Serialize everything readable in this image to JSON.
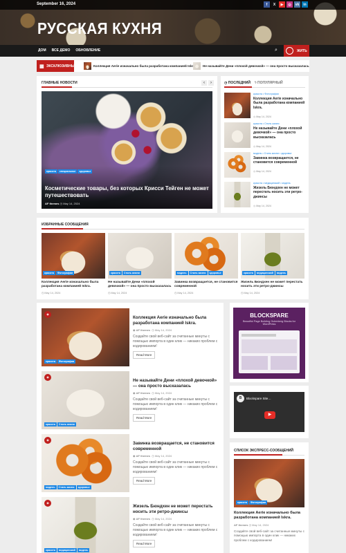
{
  "header": {
    "date": "September 16, 2024",
    "site_title": "РУССКАЯ КУХНЯ",
    "socials": [
      {
        "name": "facebook-icon",
        "glyph": "f",
        "color": "#3b5998"
      },
      {
        "name": "x-icon",
        "glyph": "X",
        "color": "#111111"
      },
      {
        "name": "youtube-icon",
        "glyph": "▶",
        "color": "#e52d27"
      },
      {
        "name": "instagram-icon",
        "glyph": "◎",
        "color": "#c13584"
      },
      {
        "name": "vk-icon",
        "glyph": "vk",
        "color": "#4a76a8"
      },
      {
        "name": "linkedin-icon",
        "glyph": "in",
        "color": "#0077b5"
      }
    ],
    "nav": [
      "ДОМ",
      "ВСЕ ДЕМО",
      "ОБНОВЛЕНИЕ"
    ],
    "live_label": "ЖИТЬ"
  },
  "exclusive": {
    "label": "ЭКСКЛЮЗИВНЫЙ",
    "items": [
      "Коллекция Aerie изначально была разработана компанией Iskra.",
      "Не называйте Дени «плохой девочкой» — она просто высказалась"
    ]
  },
  "main_news": {
    "heading": "ГЛАВНЫЕ НОВОСТИ",
    "hero": {
      "tags": [
        "красота",
        "специальное",
        "здоровье"
      ],
      "title": "Косметические товары, без которых Крисси Тейген не может путешествовать",
      "author": "AF themes",
      "date": "May 14, 2024"
    }
  },
  "tabs": {
    "latest": "ПОСЛЕДНИЙ",
    "popular": "ПОПУЛЯРНЫЙ"
  },
  "latest": [
    {
      "tags": "красота • Фотографии",
      "title": "Коллекция Aerie изначально была разработана компанией Iskra.",
      "date": "May 14, 2024",
      "img": "img-cake"
    },
    {
      "tags": "красота • Стиль жизни",
      "title": "Не называйте Дени «плохой девочкой» — она просто высказалась",
      "date": "May 14, 2024",
      "img": "img-dumplings"
    },
    {
      "tags": "модель • Стиль жизни • здоровье",
      "title": "Завинка возвращается, не становится современной",
      "date": "May 14, 2024",
      "img": "img-bagels"
    },
    {
      "tags": "красота • медицинский • модель",
      "title": "Жизель Бюндхен не может перестать носить эти ретро-джинсы",
      "date": "May 14, 2024",
      "img": "img-pickles"
    }
  ],
  "featured": {
    "heading": "ИЗБРАННЫЕ СООБЩЕНИЯ",
    "items": [
      {
        "tags": [
          "красота",
          "Фотографии"
        ],
        "title": "Коллекция Aerie изначально была разработана компанией Iskra.",
        "date": "May 14, 2024",
        "img": "img-cake"
      },
      {
        "tags": [
          "красота",
          "Стиль жизни"
        ],
        "title": "Не называйте Дени «плохой девочкой» — она просто высказалась",
        "date": "May 14, 2024",
        "img": "img-dumplings"
      },
      {
        "tags": [
          "модель",
          "Стиль жизни",
          "здоровье"
        ],
        "title": "Завинка возвращается, не становится современной",
        "date": "May 14, 2024",
        "img": "img-bagels"
      },
      {
        "tags": [
          "красота",
          "медицинский",
          "модель"
        ],
        "title": "Жизель Бюндхен не может перестать носить эти ретро-джинсы",
        "date": "May 14, 2024",
        "img": "img-pickles"
      }
    ]
  },
  "posts": [
    {
      "tags": [
        "красота",
        "Фотографии"
      ],
      "title": "Коллекция Aerie изначально была разработана компанией Iskra.",
      "author": "AF themes",
      "date": "May 14, 2024",
      "excerpt": "Создайте свой веб-сайт за считанные минуты с помощью импорта в один клик — никаких проблем с кодированием!",
      "more": "Read More",
      "img": "img-cake"
    },
    {
      "tags": [
        "красота",
        "Стиль жизни"
      ],
      "title": "Не называйте Дени «плохой девочкой» — она просто высказалась",
      "author": "AF themes",
      "date": "May 14, 2024",
      "excerpt": "Создайте свой веб-сайт за считанные минуты с помощью импорта в один клик — никаких проблем с кодированием!",
      "more": "Read More",
      "img": "img-dumplings"
    },
    {
      "tags": [
        "модель",
        "Стиль жизни",
        "здоровье"
      ],
      "title": "Завинка возвращается, не становится современной",
      "author": "AF themes",
      "date": "May 14, 2024",
      "excerpt": "Создайте свой веб-сайт за считанные минуты с помощью импорта в один клик — никаких проблем с кодированием!",
      "more": "Read More",
      "img": "img-bagels"
    },
    {
      "tags": [
        "красота",
        "медицинский",
        "модель"
      ],
      "title": "Жизель Бюндхен не может перестать носить эти ретро-джинсы",
      "author": "AF themes",
      "date": "May 14, 2024",
      "excerpt": "Создайте свой веб-сайт за считанные минуты с помощью импорта в один клик — никаких проблем с кодированием!",
      "more": "Read More",
      "img": "img-pickles"
    }
  ],
  "sidebar": {
    "ad_title": "BLOCKSPARE",
    "ad_subtitle": "Beautiful Page Building Gutenberg Blocks for WordPress",
    "video_title": "Blockspare Site…",
    "express_heading": "СПИСОК ЭКСПРЕСС-СООБЩЕНИЙ",
    "express_post": {
      "tags": [
        "красота",
        "Фотографии"
      ],
      "title": "Коллекция Aerie изначально была разработана компанией Iskra.",
      "author": "AF themes",
      "date": "May 14, 2024",
      "excerpt": "Создайте свой веб-сайт за считанные минуты с помощью импорта в один клик — никаких проблем с кодированием!"
    }
  }
}
